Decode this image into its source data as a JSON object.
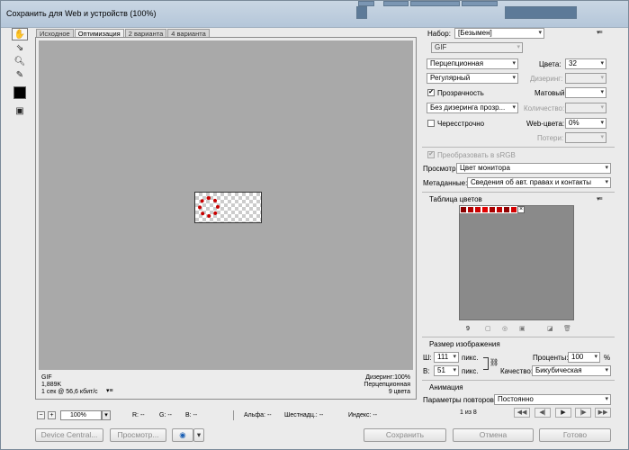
{
  "window": {
    "title": "Сохранить для Web и устройств (100%)"
  },
  "tabs": [
    "Исходное",
    "Оптимизация",
    "2 варианта",
    "4 варианта"
  ],
  "active_tab": "Оптимизация",
  "info_left": {
    "format": "GIF",
    "size": "1,889K",
    "speed": "1 сек @ 56,6 кбит/с"
  },
  "info_right": {
    "dither": "Дизеринг:100%",
    "palette": "Перцепционная",
    "colors": "9 цвета"
  },
  "status": {
    "zoom": "100%",
    "r": "R: --",
    "g": "G: --",
    "b": "B: --",
    "alpha": "Альфа: --",
    "hex": "Шестнадц.: --",
    "index": "Индекс: --"
  },
  "buttons": {
    "device_central": "Device Central...",
    "preview": "Просмотр...",
    "save": "Сохранить",
    "cancel": "Отмена",
    "done": "Готово"
  },
  "settings": {
    "preset_label": "Набор:",
    "preset_value": "[Безымен]",
    "format": "GIF",
    "reduction": "Перцепционная",
    "colors_label": "Цвета:",
    "colors_value": "32",
    "dither_algo": "Регулярный",
    "dither_label": "Дизеринг:",
    "transparency_label": "Прозрачность",
    "transparency_checked": true,
    "matte_label": "Матовый:",
    "transparency_dither": "Без дизеринга прозр...",
    "amount_label": "Количество:",
    "interlaced_label": "Чересстрочно",
    "interlaced_checked": false,
    "web_snap_label": "Web-цвета:",
    "web_snap_value": "0%",
    "lossy_label": "Потери:",
    "convert_srgb_label": "Преобразовать в sRGB",
    "convert_srgb_checked": true,
    "preview_label": "Просмотр:",
    "preview_value": "Цвет монитора",
    "metadata_label": "Метаданные:",
    "metadata_value": "Сведения об авт. правах и контакты"
  },
  "color_table": {
    "title": "Таблица цветов",
    "count": "9",
    "swatches": [
      "#8b0000",
      "#b30000",
      "#cc0000",
      "#e00000",
      "#a80000",
      "#c00000",
      "#900000",
      "#d40000"
    ]
  },
  "image_size": {
    "title": "Размер изображения",
    "w_label": "Ш:",
    "w_value": "111",
    "w_unit": "пикс.",
    "h_label": "В:",
    "h_value": "51",
    "h_unit": "пикс.",
    "percent_label": "Проценты:",
    "percent_value": "100",
    "percent_unit": "%",
    "quality_label": "Качество:",
    "quality_value": "Бикубическая"
  },
  "animation": {
    "title": "Анимация",
    "loop_label": "Параметры повторов:",
    "loop_value": "Постоянно",
    "frame": "1 из 8"
  }
}
